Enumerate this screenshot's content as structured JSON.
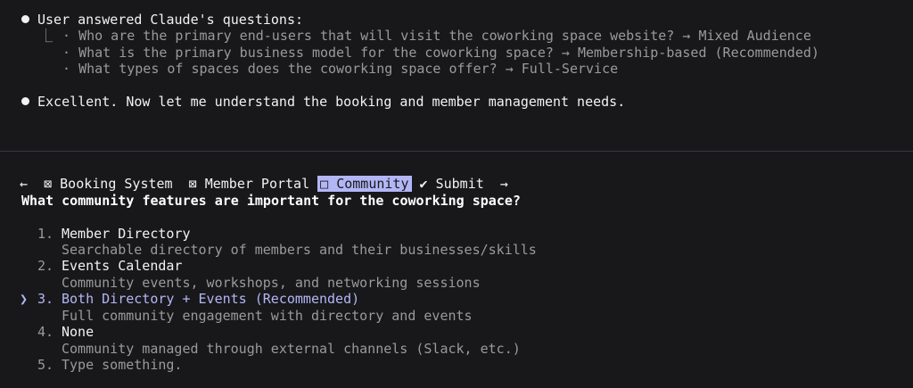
{
  "transcript": {
    "answered_header": "User answered Claude's questions:",
    "tree_glyph": "⎿",
    "qa": [
      {
        "question": "Who are the primary end-users that will visit the coworking space website?",
        "answer": "Mixed Audience"
      },
      {
        "question": "What is the primary business model for the coworking space?",
        "answer": "Membership-based (Recommended)"
      },
      {
        "question": "What types of spaces does the coworking space offer?",
        "answer": "Full-Service"
      }
    ],
    "assistant_message": "Excellent. Now let me understand the booking and member management needs."
  },
  "nav": {
    "prev_arrow": "←",
    "next_arrow": "→",
    "tabs": [
      {
        "glyph": "⊠",
        "label": "Booking System",
        "state": "answered"
      },
      {
        "glyph": "⊠",
        "label": "Member Portal",
        "state": "answered"
      },
      {
        "glyph": "□",
        "label": "Community",
        "state": "active"
      },
      {
        "glyph": "✔",
        "label": "Submit",
        "state": "submit"
      }
    ]
  },
  "question": {
    "text": "What community features are important for the coworking space?",
    "selected_pointer": "❯",
    "options": [
      {
        "number": "1.",
        "label": "Member Directory",
        "description": "Searchable directory of members and their businesses/skills"
      },
      {
        "number": "2.",
        "label": "Events Calendar",
        "description": "Community events, workshops, and networking sessions"
      },
      {
        "number": "3.",
        "label": "Both Directory + Events (Recommended)",
        "description": "Full community engagement with directory and events",
        "selected": true
      },
      {
        "number": "4.",
        "label": "None",
        "description": "Community managed through external channels (Slack, etc.)"
      },
      {
        "number": "5.",
        "label": "Type something.",
        "description": ""
      }
    ]
  },
  "colors": {
    "background": "#18181b",
    "accent": "#b3b6f5",
    "dim_text": "#9a9a9a"
  }
}
